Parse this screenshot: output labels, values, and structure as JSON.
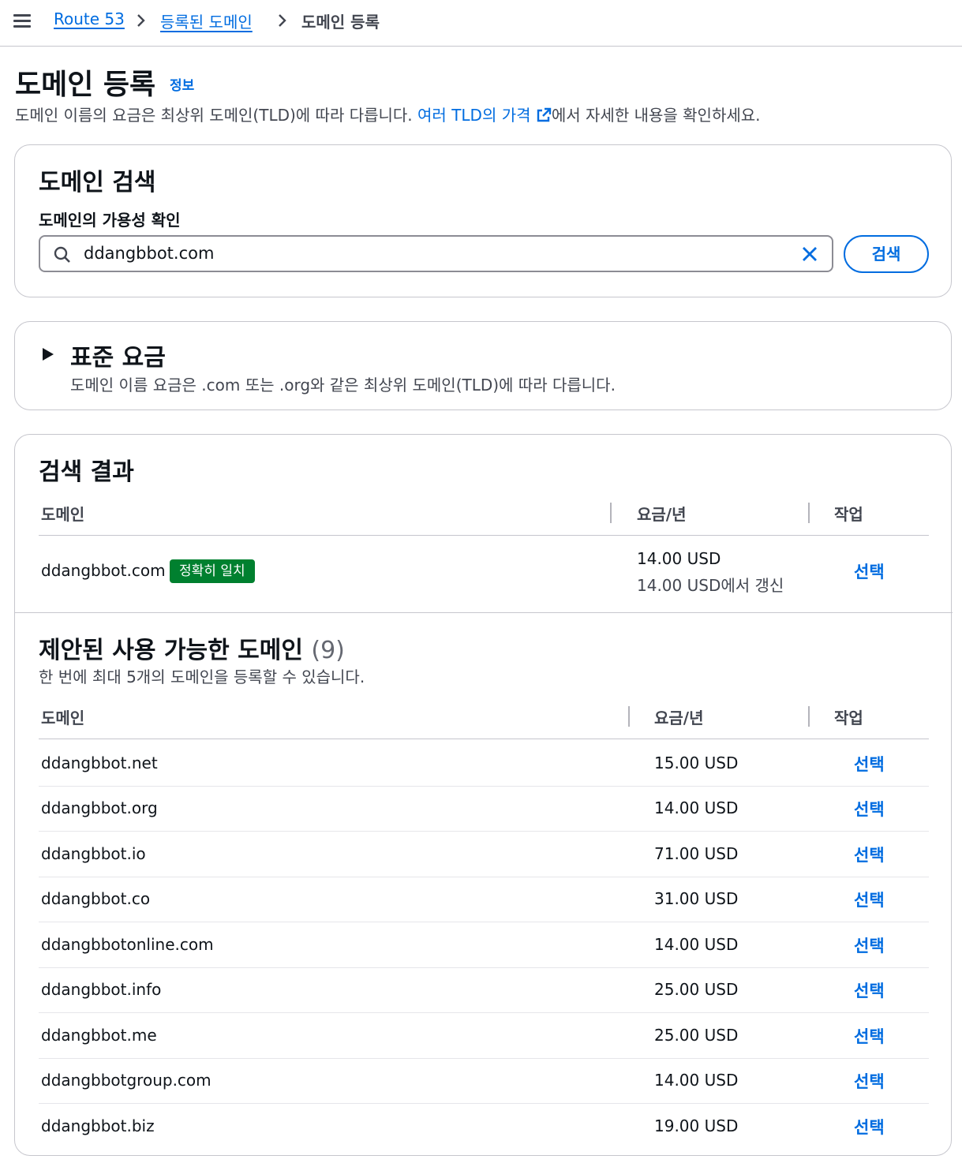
{
  "breadcrumb": {
    "items": [
      "Route 53",
      "등록된 도메인",
      "도메인 등록"
    ]
  },
  "header": {
    "title": "도메인 등록",
    "info": "정보",
    "description_prefix": "도메인 이름의 요금은 최상위 도메인(TLD)에 따라 다릅니다. ",
    "description_link": "여러 TLD의 가격",
    "description_suffix": "에서 자세한 내용을 확인하세요."
  },
  "search_section": {
    "title": "도메인 검색",
    "field_label": "도메인의 가용성 확인",
    "value": "ddangbbot.com",
    "button": "검색"
  },
  "pricing_section": {
    "title": "표준 요금",
    "description": "도메인 이름 요금은 .com 또는 .org와 같은 최상위 도메인(TLD)에 따라 다릅니다."
  },
  "results": {
    "title": "검색 결과",
    "columns": [
      "도메인",
      "요금/년",
      "작업"
    ],
    "exact": {
      "domain": "ddangbbot.com",
      "badge": "정확히 일치",
      "price": "14.00 USD",
      "renewal": "14.00 USD에서 갱신",
      "action": "선택"
    },
    "suggested_title": "제안된 사용 가능한 도메인",
    "suggested_count": "(9)",
    "suggested_description": "한 번에 최대 5개의 도메인을 등록할 수 있습니다.",
    "suggested": [
      {
        "domain": "ddangbbot.net",
        "price": "15.00 USD",
        "action": "선택"
      },
      {
        "domain": "ddangbbot.org",
        "price": "14.00 USD",
        "action": "선택"
      },
      {
        "domain": "ddangbbot.io",
        "price": "71.00 USD",
        "action": "선택"
      },
      {
        "domain": "ddangbbot.co",
        "price": "31.00 USD",
        "action": "선택"
      },
      {
        "domain": "ddangbbotonline.com",
        "price": "14.00 USD",
        "action": "선택"
      },
      {
        "domain": "ddangbbot.info",
        "price": "25.00 USD",
        "action": "선택"
      },
      {
        "domain": "ddangbbot.me",
        "price": "25.00 USD",
        "action": "선택"
      },
      {
        "domain": "ddangbbotgroup.com",
        "price": "14.00 USD",
        "action": "선택"
      },
      {
        "domain": "ddangbbot.biz",
        "price": "19.00 USD",
        "action": "선택"
      }
    ]
  },
  "colors": {
    "link": "#006ce0",
    "badge_bg": "#00802f",
    "text": "#0f141a",
    "secondary_text": "#424650",
    "border": "#c6c6cd"
  },
  "icons": [
    "menu-icon",
    "chevron-right-icon",
    "external-link-icon",
    "search-icon",
    "close-icon",
    "caret-right-icon"
  ]
}
